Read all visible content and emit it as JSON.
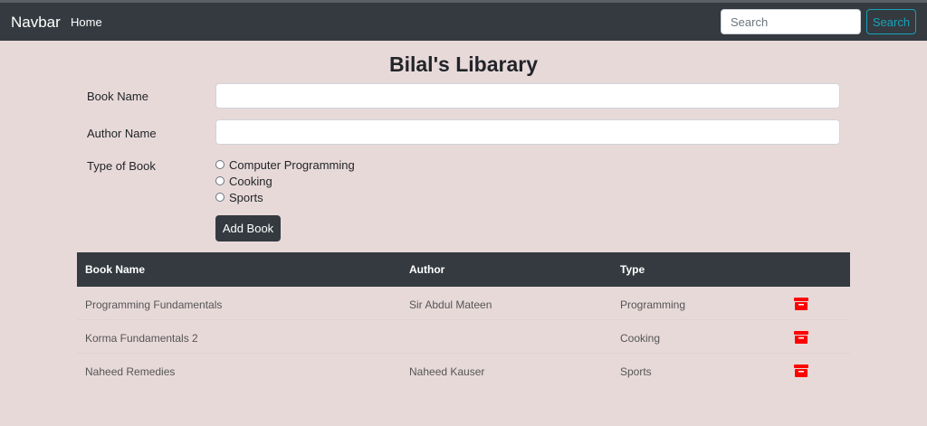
{
  "navbar": {
    "brand": "Navbar",
    "home": "Home",
    "search_placeholder": "Search",
    "search_button": "Search"
  },
  "page": {
    "title": "Bilal's Libarary"
  },
  "form": {
    "book_name_label": "Book Name",
    "book_name_value": "",
    "author_name_label": "Author Name",
    "author_name_value": "",
    "type_label": "Type of Book",
    "types": [
      "Computer Programming",
      "Cooking",
      "Sports"
    ],
    "submit": "Add Book"
  },
  "table": {
    "headers": [
      "Book Name",
      "Author",
      "Type"
    ],
    "rows": [
      [
        "Programming Fundamentals",
        "Sir Abdul Mateen",
        "Programming"
      ],
      [
        "Korma Fundamentals 2",
        "",
        "Cooking"
      ],
      [
        "Naheed Remedies",
        "Naheed Kauser",
        "Sports"
      ]
    ]
  },
  "colors": {
    "background": "#e8d9d9",
    "navbar": "#343a40",
    "search_button": "#17a2b8",
    "delete_icon": "#ff0000"
  },
  "icons": {
    "delete": "trash-icon"
  }
}
